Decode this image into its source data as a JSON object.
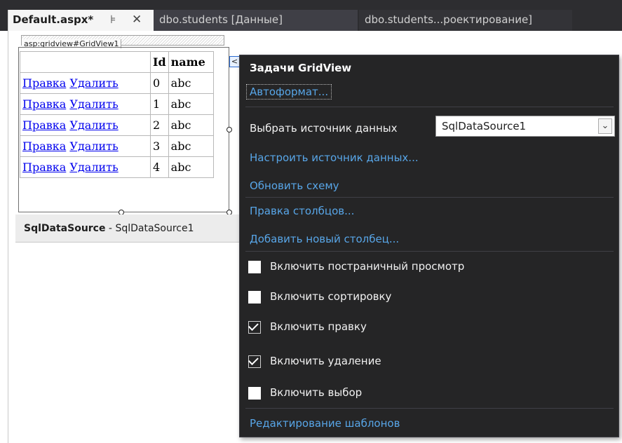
{
  "tabs": [
    {
      "label": "Default.aspx*",
      "pin_icon": "pin-icon",
      "close_icon": "close-icon"
    },
    {
      "label": "dbo.students [Данные]"
    },
    {
      "label": "dbo.students...роектирование]"
    }
  ],
  "designer": {
    "selected_tag": "asp:gridview#GridView1",
    "smart_tag_glyph": "<",
    "grid": {
      "columns": [
        "",
        "Id",
        "name"
      ],
      "rows": [
        {
          "edit": "Правка",
          "delete": "Удалить",
          "id": "0",
          "name": "abc"
        },
        {
          "edit": "Правка",
          "delete": "Удалить",
          "id": "1",
          "name": "abc"
        },
        {
          "edit": "Правка",
          "delete": "Удалить",
          "id": "2",
          "name": "abc"
        },
        {
          "edit": "Правка",
          "delete": "Удалить",
          "id": "3",
          "name": "abc"
        },
        {
          "edit": "Правка",
          "delete": "Удалить",
          "id": "4",
          "name": "abc"
        }
      ]
    },
    "datasource": {
      "type": "SqlDataSource",
      "separator": " - ",
      "id": "SqlDataSource1"
    }
  },
  "tasks": {
    "title": "Задачи GridView",
    "autoformat": "Автоформат...",
    "choose_ds_label": "Выбрать источник данных",
    "choose_ds_value": "SqlDataSource1",
    "configure_ds": "Настроить источник данных...",
    "refresh_schema": "Обновить схему",
    "edit_columns": "Правка столбцов...",
    "add_column": "Добавить новый столбец...",
    "checks": [
      {
        "label": "Включить постраничный просмотр",
        "checked": false
      },
      {
        "label": "Включить сортировку",
        "checked": false
      },
      {
        "label": "Включить правку",
        "checked": true
      },
      {
        "label": "Включить удаление",
        "checked": true
      },
      {
        "label": "Включить выбор",
        "checked": false
      }
    ],
    "edit_templates": "Редактирование шаблонов"
  }
}
